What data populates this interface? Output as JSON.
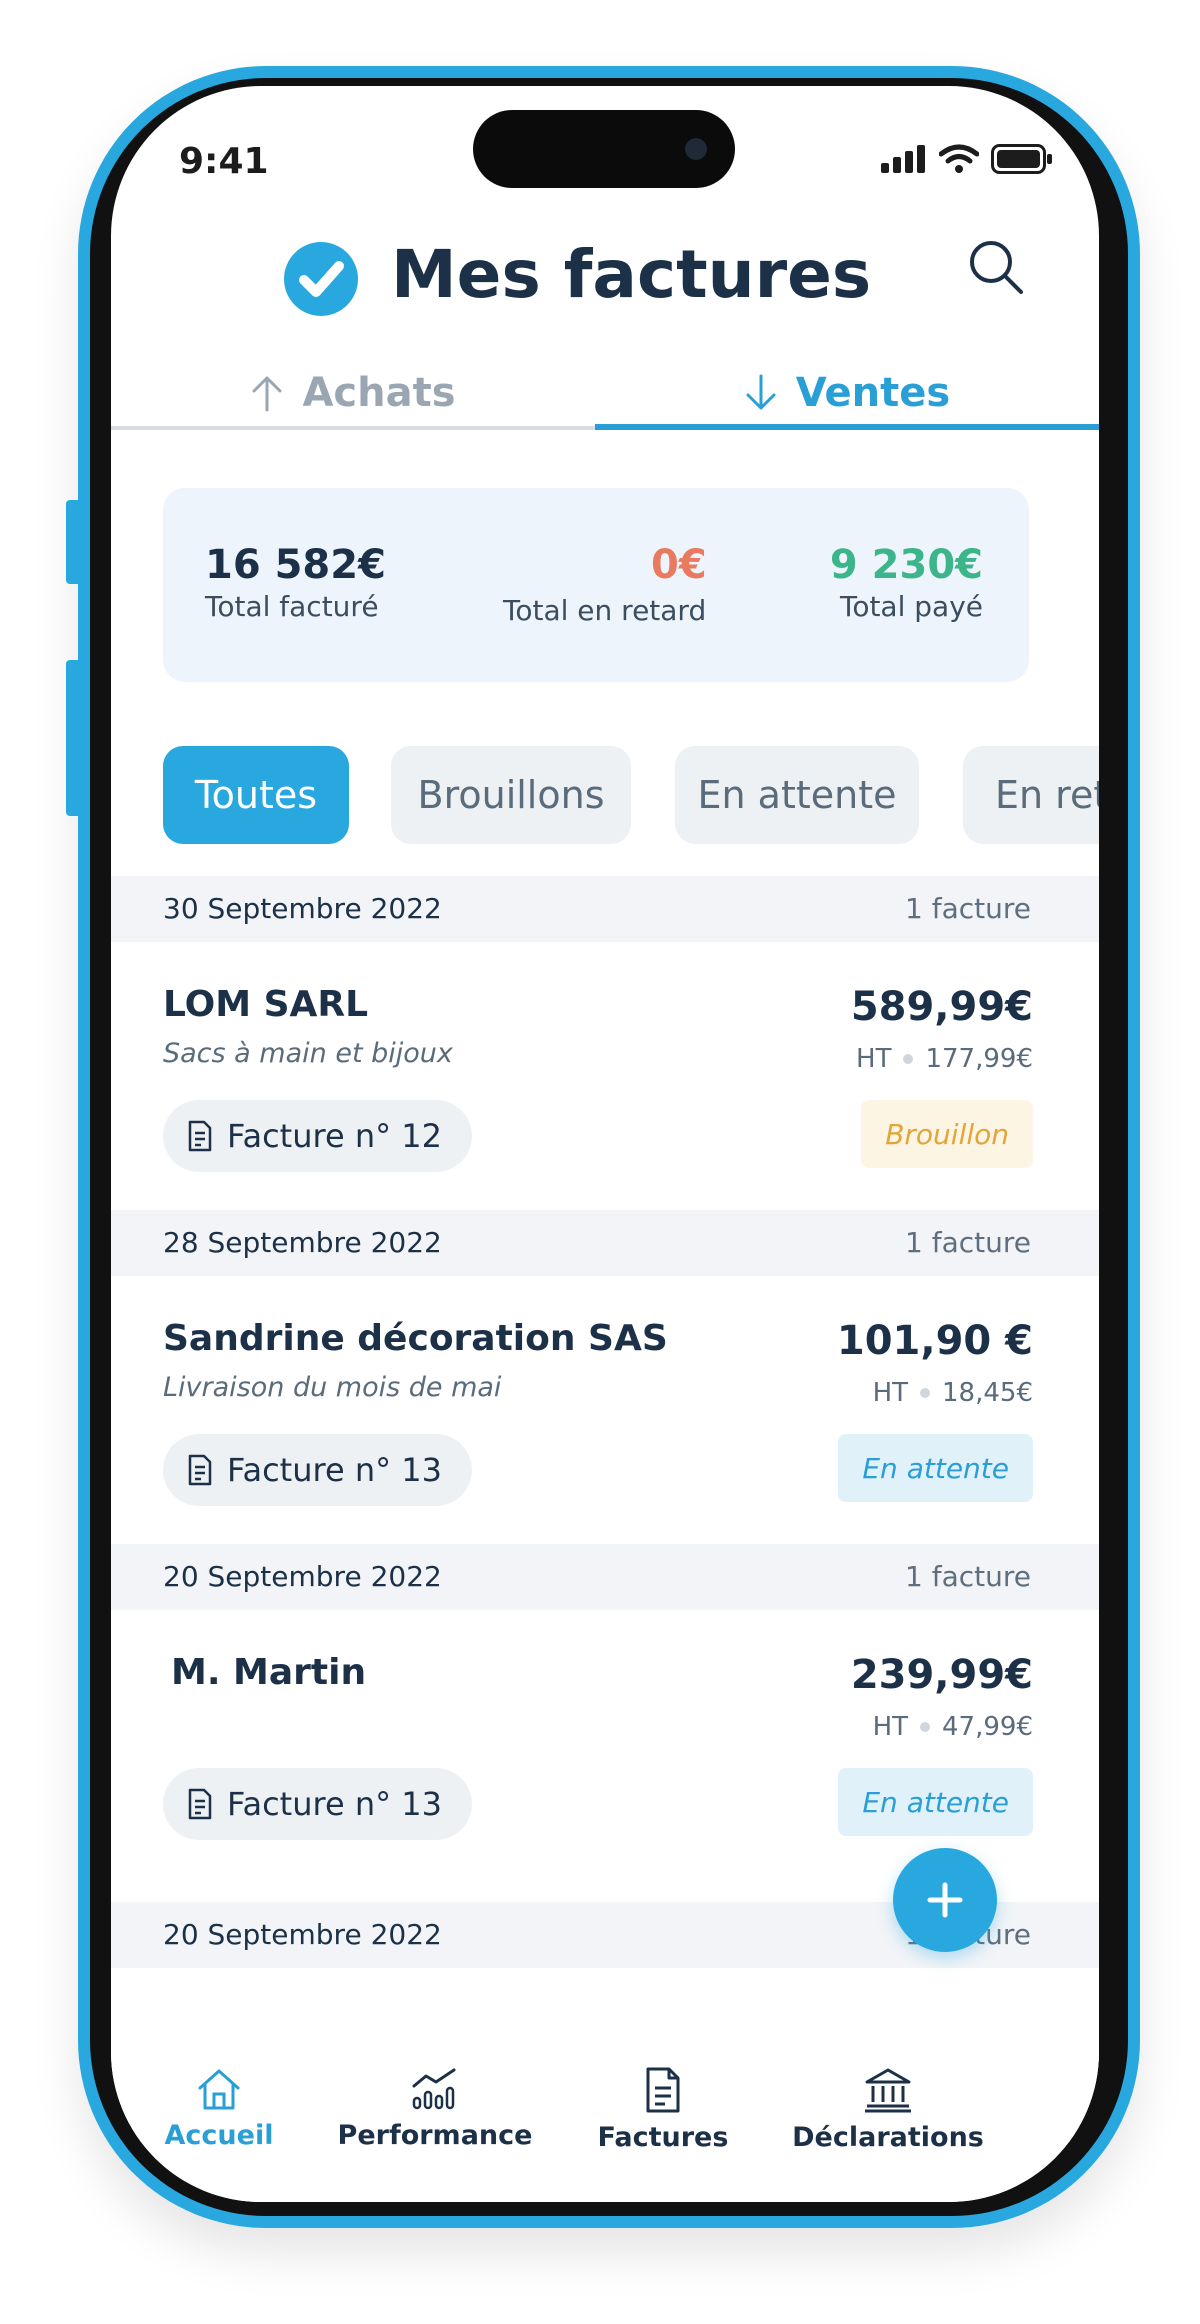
{
  "status_bar": {
    "time": "9:41"
  },
  "header": {
    "title": "Mes factures"
  },
  "tabs": [
    {
      "label": "Achats",
      "active": false
    },
    {
      "label": "Ventes",
      "active": true
    }
  ],
  "summary": {
    "total_invoiced": {
      "value": "16 582€",
      "label": "Total facturé"
    },
    "total_late": {
      "value": "0€",
      "label": "Total en retard",
      "color": "#ea7a5f"
    },
    "total_paid": {
      "value": "9 230€",
      "label": "Total payé",
      "color": "#3cb58a"
    }
  },
  "filters": [
    {
      "label": "Toutes",
      "active": true
    },
    {
      "label": "Brouillons",
      "active": false
    },
    {
      "label": "En attente",
      "active": false
    },
    {
      "label": "En retard",
      "active": false
    }
  ],
  "groups": [
    {
      "date": "30 Septembre 2022",
      "count": "1 facture",
      "invoice": {
        "client": "LOM SARL",
        "description": "Sacs à main et bijoux",
        "amount": "589,99€",
        "ht_label": "HT",
        "ht_value": "177,99€",
        "number": "Facture n° 12",
        "status": "Brouillon"
      }
    },
    {
      "date": "28 Septembre 2022",
      "count": "1 facture",
      "invoice": {
        "client": "Sandrine décoration SAS",
        "description": "Livraison du mois de mai",
        "amount": "101,90 €",
        "ht_label": "HT",
        "ht_value": "18,45€",
        "number": "Facture n° 13",
        "status": "En attente"
      }
    },
    {
      "date": "20 Septembre 2022",
      "count": "1 facture",
      "invoice": {
        "client": "M. Martin",
        "description": "",
        "amount": "239,99€",
        "ht_label": "HT",
        "ht_value": "47,99€",
        "number": "Facture n° 13",
        "status": "En attente"
      }
    },
    {
      "date": "20 Septembre 2022",
      "count": "1 facture"
    }
  ],
  "fab": {
    "icon": "plus-icon"
  },
  "bottom_nav": [
    {
      "label": "Accueil",
      "icon": "home-icon",
      "active": true
    },
    {
      "label": "Performance",
      "icon": "chart-icon",
      "active": false
    },
    {
      "label": "Factures",
      "icon": "document-icon",
      "active": false
    },
    {
      "label": "Déclarations",
      "icon": "bank-icon",
      "active": false
    }
  ],
  "colors": {
    "accent": "#29a8e0",
    "text": "#1c3148",
    "draft": "#e3a53a"
  }
}
